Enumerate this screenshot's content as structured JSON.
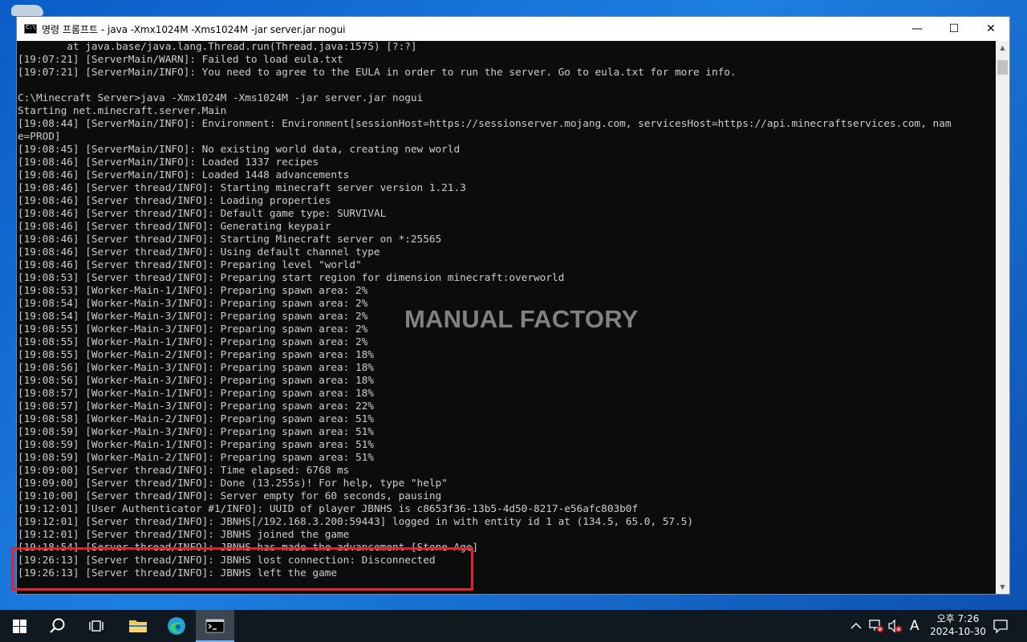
{
  "window": {
    "title": "명령 프롬프트 - java  -Xmx1024M -Xms1024M -jar server.jar nogui",
    "minimize_glyph": "—",
    "maximize_glyph": "☐",
    "close_glyph": "✕"
  },
  "console": {
    "lines": [
      "        at java.base/java.lang.Thread.run(Thread.java:1575) [?:?]",
      "[19:07:21] [ServerMain/WARN]: Failed to load eula.txt",
      "[19:07:21] [ServerMain/INFO]: You need to agree to the EULA in order to run the server. Go to eula.txt for more info.",
      "",
      "C:\\Minecraft Server>java -Xmx1024M -Xms1024M -jar server.jar nogui",
      "Starting net.minecraft.server.Main",
      "[19:08:44] [ServerMain/INFO]: Environment: Environment[sessionHost=https://sessionserver.mojang.com, servicesHost=https://api.minecraftservices.com, nam",
      "e=PROD]",
      "[19:08:45] [ServerMain/INFO]: No existing world data, creating new world",
      "[19:08:46] [ServerMain/INFO]: Loaded 1337 recipes",
      "[19:08:46] [ServerMain/INFO]: Loaded 1448 advancements",
      "[19:08:46] [Server thread/INFO]: Starting minecraft server version 1.21.3",
      "[19:08:46] [Server thread/INFO]: Loading properties",
      "[19:08:46] [Server thread/INFO]: Default game type: SURVIVAL",
      "[19:08:46] [Server thread/INFO]: Generating keypair",
      "[19:08:46] [Server thread/INFO]: Starting Minecraft server on *:25565",
      "[19:08:46] [Server thread/INFO]: Using default channel type",
      "[19:08:46] [Server thread/INFO]: Preparing level \"world\"",
      "[19:08:53] [Server thread/INFO]: Preparing start region for dimension minecraft:overworld",
      "[19:08:53] [Worker-Main-1/INFO]: Preparing spawn area: 2%",
      "[19:08:54] [Worker-Main-3/INFO]: Preparing spawn area: 2%",
      "[19:08:54] [Worker-Main-3/INFO]: Preparing spawn area: 2%",
      "[19:08:55] [Worker-Main-3/INFO]: Preparing spawn area: 2%",
      "[19:08:55] [Worker-Main-1/INFO]: Preparing spawn area: 2%",
      "[19:08:55] [Worker-Main-2/INFO]: Preparing spawn area: 18%",
      "[19:08:56] [Worker-Main-3/INFO]: Preparing spawn area: 18%",
      "[19:08:56] [Worker-Main-3/INFO]: Preparing spawn area: 18%",
      "[19:08:57] [Worker-Main-1/INFO]: Preparing spawn area: 18%",
      "[19:08:57] [Worker-Main-3/INFO]: Preparing spawn area: 22%",
      "[19:08:58] [Worker-Main-2/INFO]: Preparing spawn area: 51%",
      "[19:08:59] [Worker-Main-3/INFO]: Preparing spawn area: 51%",
      "[19:08:59] [Worker-Main-1/INFO]: Preparing spawn area: 51%",
      "[19:08:59] [Worker-Main-2/INFO]: Preparing spawn area: 51%",
      "[19:09:00] [Server thread/INFO]: Time elapsed: 6768 ms",
      "[19:09:00] [Server thread/INFO]: Done (13.255s)! For help, type \"help\"",
      "[19:10:00] [Server thread/INFO]: Server empty for 60 seconds, pausing",
      "[19:12:01] [User Authenticator #1/INFO]: UUID of player JBNHS is c8653f36-13b5-4d50-8217-e56afc803b0f",
      "[19:12:01] [Server thread/INFO]: JBNHS[/192.168.3.200:59443] logged in with entity id 1 at (134.5, 65.0, 57.5)",
      "[19:12:01] [Server thread/INFO]: JBNHS joined the game",
      "[19:18:54] [Server thread/INFO]: JBNHS has made the advancement [Stone Age]",
      "[19:26:13] [Server thread/INFO]: JBNHS lost connection: Disconnected",
      "[19:26:13] [Server thread/INFO]: JBNHS left the game"
    ]
  },
  "watermark": "MANUAL FACTORY",
  "taskbar": {
    "apps": [
      "start",
      "search",
      "task-view",
      "file-explorer",
      "edge",
      "command-prompt"
    ],
    "active_app": "command-prompt",
    "tray": {
      "ime_glyph": "A",
      "time": "오후 7:26",
      "date": "2024-10-30"
    }
  },
  "colors": {
    "console_bg": "#0c0c0c",
    "console_text": "#cccccc",
    "highlight": "#e0242a",
    "taskbar": "#101820"
  }
}
